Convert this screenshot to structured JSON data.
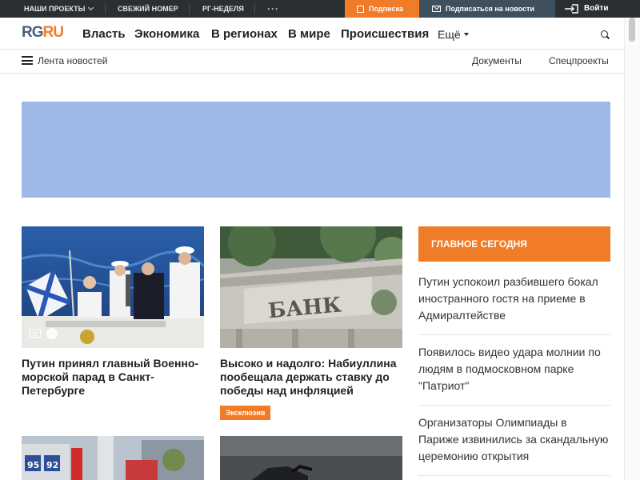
{
  "topbar": {
    "projects_label": "Наши проекты",
    "fresh_issue_label": "Свежий номер",
    "week_label": "РГ-Неделя",
    "more_dots": "···",
    "subscribe_label": "Подписка",
    "news_subscribe_label": "Подписаться на новости",
    "login_label": "Войти"
  },
  "nav": {
    "logo_rg": "RG",
    "logo_ru": "RU",
    "items": [
      "Власть",
      "Экономика",
      "В регионах",
      "В мире",
      "Происшествия"
    ],
    "more_label": "Ещё"
  },
  "subnav": {
    "feed_label": "Лента новостей",
    "documents_label": "Документы",
    "special_label": "Спецпроекты"
  },
  "cards": [
    {
      "title": "Путин принял главный Военно-морской парад в Санкт-Петербурге"
    },
    {
      "title": "Высоко и надолго: Набиуллина пообещала держать ставку до победы над инфляцией",
      "badge": "Эксклюзив"
    }
  ],
  "bank_sign": "БАНК",
  "sidebar": {
    "heading": "Главное сегодня",
    "items": [
      "Путин успокоил разбившего бокал иностранного гостя на приеме в Адмиралтействе",
      "Появилось видео удара молнии по людям в подмосковном парке \"Патриот\"",
      "Организаторы Олимпиады в Париже извинились за скандальную церемонию открытия"
    ]
  },
  "fuel_numbers": [
    "95",
    "92"
  ],
  "colors": {
    "accent": "#f07c28",
    "topbar": "#2b2f33",
    "news_button": "#3e4f5e",
    "ad_placeholder": "#9db9e8",
    "logo_rg": "#4a5d7e"
  }
}
